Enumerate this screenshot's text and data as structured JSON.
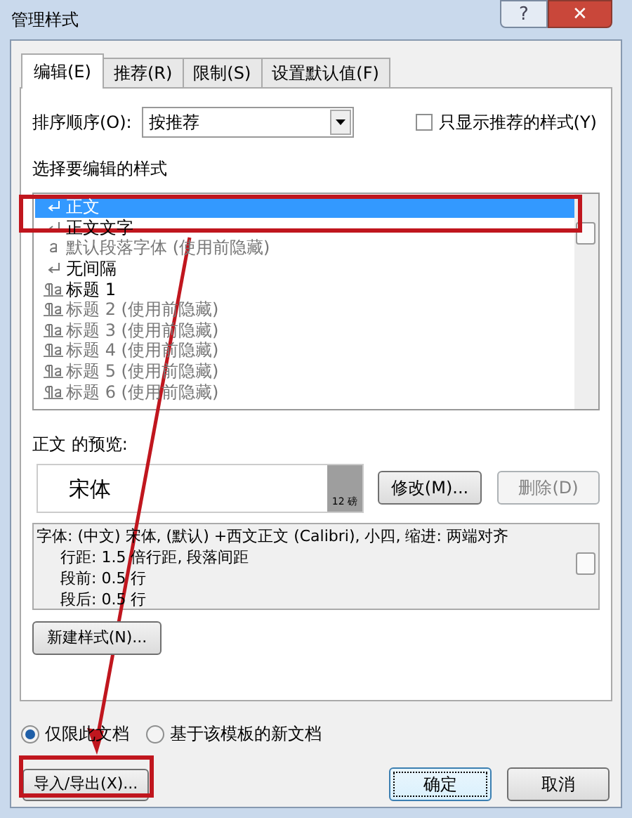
{
  "window": {
    "title": "管理样式",
    "help": "?",
    "close": "✕"
  },
  "tabs": [
    {
      "label": "编辑(E)",
      "selected": true
    },
    {
      "label": "推荐(R)",
      "selected": false
    },
    {
      "label": "限制(S)",
      "selected": false
    },
    {
      "label": "设置默认值(F)",
      "selected": false
    }
  ],
  "sort": {
    "label": "排序顺序(O):",
    "value": "按推荐",
    "recommended_only": {
      "label": "只显示推荐的样式(Y)",
      "checked": false
    }
  },
  "styles_label": "选择要编辑的样式",
  "styles": [
    {
      "name": "正文",
      "kind": "paragraph",
      "selected": true,
      "dimmed": false
    },
    {
      "name": "正文文字",
      "kind": "paragraph",
      "selected": false,
      "dimmed": false
    },
    {
      "name": "默认段落字体 (使用前隐藏)",
      "kind": "character",
      "selected": false,
      "dimmed": true
    },
    {
      "name": "无间隔",
      "kind": "paragraph",
      "selected": false,
      "dimmed": false
    },
    {
      "name": "标题 1",
      "kind": "linked",
      "selected": false,
      "dimmed": false
    },
    {
      "name": "标题 2 (使用前隐藏)",
      "kind": "linked",
      "selected": false,
      "dimmed": true
    },
    {
      "name": "标题 3 (使用前隐藏)",
      "kind": "linked",
      "selected": false,
      "dimmed": true
    },
    {
      "name": "标题 4 (使用前隐藏)",
      "kind": "linked",
      "selected": false,
      "dimmed": true
    },
    {
      "name": "标题 5 (使用前隐藏)",
      "kind": "linked",
      "selected": false,
      "dimmed": true
    },
    {
      "name": "标题 6 (使用前隐藏)",
      "kind": "linked",
      "selected": false,
      "dimmed": true
    }
  ],
  "preview": {
    "label": "正文 的预览:",
    "sample": "宋体",
    "size": "12 磅"
  },
  "modify_button": {
    "label": "修改(M)...",
    "disabled": false
  },
  "delete_button": {
    "label": "删除(D)",
    "disabled": true
  },
  "description": [
    {
      "text": "字体: (中文) 宋体, (默认) +西文正文 (Calibri), 小四, 缩进: 两端对齐",
      "indented": false
    },
    {
      "text": "行距: 1.5 倍行距, 段落间距",
      "indented": true
    },
    {
      "text": "段前: 0.5 行",
      "indented": true
    },
    {
      "text": "段后: 0.5 行",
      "indented": true
    }
  ],
  "new_style_button": "新建样式(N)...",
  "scope": [
    {
      "label": "仅限此文档",
      "selected": true
    },
    {
      "label": "基于该模板的新文档",
      "selected": false
    }
  ],
  "buttons": {
    "import_export": "导入/导出(X)...",
    "ok": "确定",
    "cancel": "取消"
  }
}
